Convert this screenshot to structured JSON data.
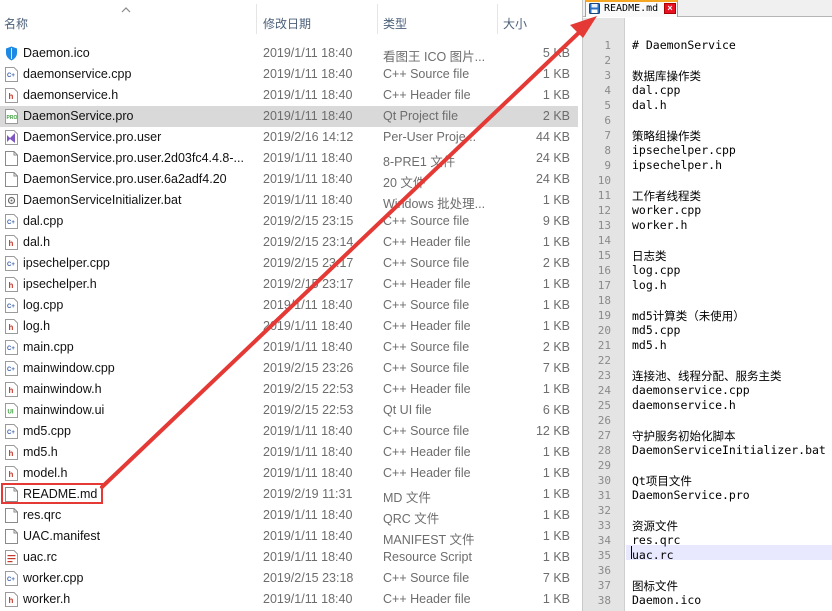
{
  "columns": {
    "name": "名称",
    "date": "修改日期",
    "type": "类型",
    "size": "大小"
  },
  "files": [
    {
      "name": "Daemon.ico",
      "date": "2019/1/11 18:40",
      "type": "看图王 ICO 图片...",
      "size": "5 KB",
      "icon": "ico-shield-icon"
    },
    {
      "name": "daemonservice.cpp",
      "date": "2019/1/11 18:40",
      "type": "C++ Source file",
      "size": "1 KB",
      "icon": "cpp-file-icon"
    },
    {
      "name": "daemonservice.h",
      "date": "2019/1/11 18:40",
      "type": "C++ Header file",
      "size": "1 KB",
      "icon": "header-file-icon"
    },
    {
      "name": "DaemonService.pro",
      "date": "2019/1/11 18:40",
      "type": "Qt Project file",
      "size": "2 KB",
      "icon": "qt-project-icon"
    },
    {
      "name": "DaemonService.pro.user",
      "date": "2019/2/16 14:12",
      "type": "Per-User Proje...",
      "size": "44 KB",
      "icon": "vs-user-icon"
    },
    {
      "name": "DaemonService.pro.user.2d03fc4.4.8-...",
      "date": "2019/1/11 18:40",
      "type": "8-PRE1 文件",
      "size": "24 KB",
      "icon": "blank-file-icon"
    },
    {
      "name": "DaemonService.pro.user.6a2adf4.20",
      "date": "2019/1/11 18:40",
      "type": "20 文件",
      "size": "24 KB",
      "icon": "blank-file-icon"
    },
    {
      "name": "DaemonServiceInitializer.bat",
      "date": "2019/1/11 18:40",
      "type": "Windows 批处理...",
      "size": "1 KB",
      "icon": "bat-file-icon"
    },
    {
      "name": "dal.cpp",
      "date": "2019/2/15 23:15",
      "type": "C++ Source file",
      "size": "9 KB",
      "icon": "cpp-file-icon"
    },
    {
      "name": "dal.h",
      "date": "2019/2/15 23:14",
      "type": "C++ Header file",
      "size": "1 KB",
      "icon": "header-file-icon"
    },
    {
      "name": "ipsechelper.cpp",
      "date": "2019/2/15 23:17",
      "type": "C++ Source file",
      "size": "2 KB",
      "icon": "cpp-file-icon"
    },
    {
      "name": "ipsechelper.h",
      "date": "2019/2/15 23:17",
      "type": "C++ Header file",
      "size": "1 KB",
      "icon": "header-file-icon"
    },
    {
      "name": "log.cpp",
      "date": "2019/1/11 18:40",
      "type": "C++ Source file",
      "size": "1 KB",
      "icon": "cpp-file-icon"
    },
    {
      "name": "log.h",
      "date": "2019/1/11 18:40",
      "type": "C++ Header file",
      "size": "1 KB",
      "icon": "header-file-icon"
    },
    {
      "name": "main.cpp",
      "date": "2019/1/11 18:40",
      "type": "C++ Source file",
      "size": "2 KB",
      "icon": "cpp-file-icon"
    },
    {
      "name": "mainwindow.cpp",
      "date": "2019/2/15 23:26",
      "type": "C++ Source file",
      "size": "7 KB",
      "icon": "cpp-file-icon"
    },
    {
      "name": "mainwindow.h",
      "date": "2019/2/15 22:53",
      "type": "C++ Header file",
      "size": "1 KB",
      "icon": "header-file-icon"
    },
    {
      "name": "mainwindow.ui",
      "date": "2019/2/15 22:53",
      "type": "Qt UI file",
      "size": "6 KB",
      "icon": "ui-file-icon"
    },
    {
      "name": "md5.cpp",
      "date": "2019/1/11 18:40",
      "type": "C++ Source file",
      "size": "12 KB",
      "icon": "cpp-file-icon"
    },
    {
      "name": "md5.h",
      "date": "2019/1/11 18:40",
      "type": "C++ Header file",
      "size": "1 KB",
      "icon": "header-file-icon"
    },
    {
      "name": "model.h",
      "date": "2019/1/11 18:40",
      "type": "C++ Header file",
      "size": "1 KB",
      "icon": "header-file-icon"
    },
    {
      "name": "README.md",
      "date": "2019/2/19 11:31",
      "type": "MD 文件",
      "size": "1 KB",
      "icon": "blank-file-icon"
    },
    {
      "name": "res.qrc",
      "date": "2019/1/11 18:40",
      "type": "QRC 文件",
      "size": "1 KB",
      "icon": "blank-file-icon"
    },
    {
      "name": "UAC.manifest",
      "date": "2019/1/11 18:40",
      "type": "MANIFEST 文件",
      "size": "1 KB",
      "icon": "blank-file-icon"
    },
    {
      "name": "uac.rc",
      "date": "2019/1/11 18:40",
      "type": "Resource Script",
      "size": "1 KB",
      "icon": "rc-file-icon"
    },
    {
      "name": "worker.cpp",
      "date": "2019/2/15 23:18",
      "type": "C++ Source file",
      "size": "7 KB",
      "icon": "cpp-file-icon"
    },
    {
      "name": "worker.h",
      "date": "2019/1/11 18:40",
      "type": "C++ Header file",
      "size": "1 KB",
      "icon": "header-file-icon"
    }
  ],
  "selected_file": "DaemonService.pro",
  "highlighted_file": "README.md",
  "editor": {
    "tab_title": "README.md",
    "current_line": 36,
    "lines": [
      "# DaemonService",
      "",
      "数据库操作类",
      "dal.cpp",
      "dal.h",
      "",
      "策略组操作类",
      "ipsechelper.cpp",
      "ipsechelper.h",
      "",
      "工作者线程类",
      "worker.cpp",
      "worker.h",
      "",
      "日志类",
      "log.cpp",
      "log.h",
      "",
      "md5计算类（未使用）",
      "md5.cpp",
      "md5.h",
      "",
      "连接池、线程分配、服务主类",
      "daemonservice.cpp",
      "daemonservice.h",
      "",
      "守护服务初始化脚本",
      "DaemonServiceInitializer.bat",
      "",
      "Qt项目文件",
      "DaemonService.pro",
      "",
      "资源文件",
      "res.qrc",
      "uac.rc",
      "",
      "图标文件",
      "Daemon.ico"
    ]
  },
  "colors": {
    "annotation_red": "#e53935",
    "selected_row": "#d9d9d9",
    "gutter": "#e4e4e4"
  }
}
